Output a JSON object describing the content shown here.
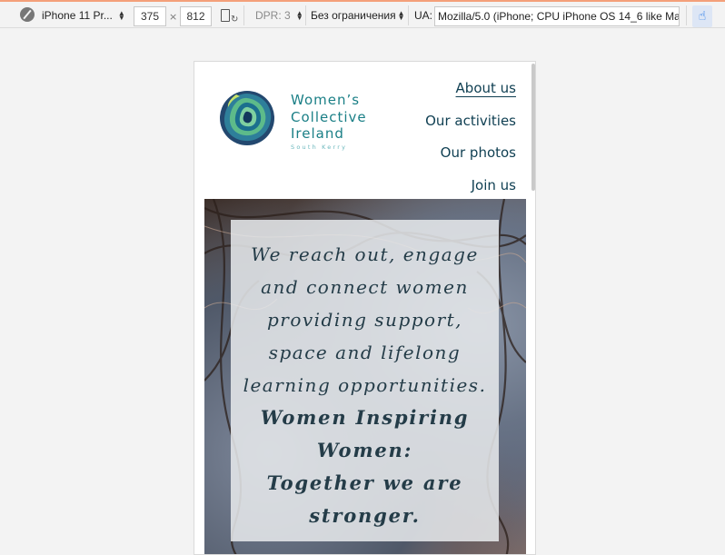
{
  "toolbar": {
    "device": "iPhone 11 Pr...",
    "width": "375",
    "times": "×",
    "height": "812",
    "dpr": "DPR: 3",
    "throttling": "Без ограничения",
    "ua_label": "UA:",
    "ua_value": "Mozilla/5.0 (iPhone; CPU iPhone OS 14_6 like Mac"
  },
  "site": {
    "brand_lines": [
      "Women’s",
      "Collective",
      "Ireland"
    ],
    "brand_sub": "South Kerry",
    "nav": [
      "About us",
      "Our activities",
      "Our photos",
      "Join us"
    ]
  },
  "hero": {
    "lines": [
      "We reach out, engage",
      "and connect women",
      "providing support,",
      "space and lifelong",
      "learning opportunities."
    ],
    "bold_lines": [
      "Women Inspiring",
      "Women:",
      "Together we are",
      "stronger."
    ]
  }
}
